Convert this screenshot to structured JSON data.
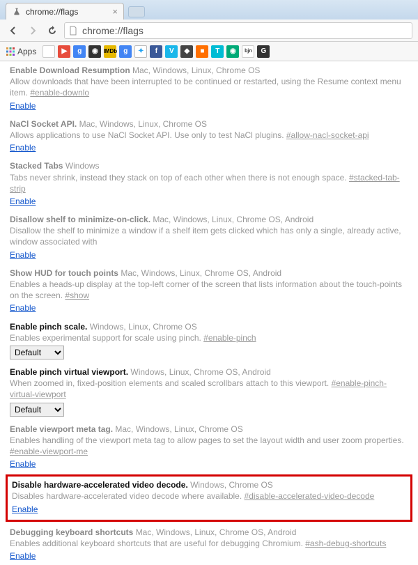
{
  "tab": {
    "title": "chrome://flags"
  },
  "url": "chrome://flags",
  "bookmarks_label": "Apps",
  "flags": [
    {
      "title": "Enable Download Resumption",
      "gray": true,
      "platforms": "Mac, Windows, Linux, Chrome OS",
      "desc": "Allow downloads that have been interrupted to be continued or restarted, using the Resume context menu item.",
      "anchor": "#enable-downlo",
      "action": "link",
      "link": "Enable"
    },
    {
      "title": "NaCl Socket API.",
      "gray": true,
      "platforms": "Mac, Windows, Linux, Chrome OS",
      "desc": "Allows applications to use NaCl Socket API. Use only to test NaCl plugins.",
      "anchor": "#allow-nacl-socket-api",
      "action": "link",
      "link": "Enable"
    },
    {
      "title": "Stacked Tabs",
      "gray": true,
      "platforms": "Windows",
      "desc": "Tabs never shrink, instead they stack on top of each other when there is not enough space.",
      "anchor": "#stacked-tab-strip",
      "action": "link",
      "link": "Enable"
    },
    {
      "title": "Disallow shelf to minimize-on-click.",
      "gray": true,
      "platforms": "Mac, Windows, Linux, Chrome OS, Android",
      "desc": "Disallow the shelf to minimize a window if a shelf item gets clicked which has only a single, already active, window associated with",
      "anchor": "",
      "action": "link",
      "link": "Enable"
    },
    {
      "title": "Show HUD for touch points",
      "gray": true,
      "platforms": "Mac, Windows, Linux, Chrome OS, Android",
      "desc": "Enables a heads-up display at the top-left corner of the screen that lists information about the touch-points on the screen.",
      "anchor": "#show",
      "action": "link",
      "link": "Enable"
    },
    {
      "title": "Enable pinch scale.",
      "gray": false,
      "platforms": "Windows, Linux, Chrome OS",
      "desc": "Enables experimental support for scale using pinch.",
      "anchor": "#enable-pinch",
      "action": "select",
      "selected": "Default"
    },
    {
      "title": "Enable pinch virtual viewport.",
      "gray": false,
      "platforms": "Windows, Linux, Chrome OS, Android",
      "desc": "When zoomed in, fixed-position elements and scaled scrollbars attach to this viewport.",
      "anchor": "#enable-pinch-virtual-viewport",
      "action": "select",
      "selected": "Default"
    },
    {
      "title": "Enable viewport meta tag.",
      "gray": true,
      "platforms": "Mac, Windows, Linux, Chrome OS",
      "desc": "Enables handling of the viewport meta tag to allow pages to set the layout width and user zoom properties.",
      "anchor": "#enable-viewport-me",
      "action": "link",
      "link": "Enable"
    },
    {
      "title": "Disable hardware-accelerated video decode.",
      "gray": false,
      "platforms": "Windows, Chrome OS",
      "desc": "Disables hardware-accelerated video decode where available.",
      "anchor": "#disable-accelerated-video-decode",
      "action": "link",
      "link": "Enable",
      "highlight": true
    },
    {
      "title": "Debugging keyboard shortcuts",
      "gray": true,
      "platforms": "Mac, Windows, Linux, Chrome OS, Android",
      "desc": "Enables additional keyboard shortcuts that are useful for debugging Chromium.",
      "anchor": "#ash-debug-shortcuts",
      "action": "link",
      "link": "Enable"
    }
  ]
}
